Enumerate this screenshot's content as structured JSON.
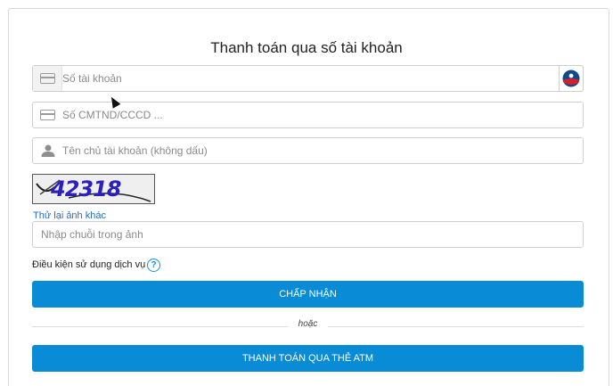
{
  "title": "Thanh toán qua số tài khoản",
  "fields": {
    "account_number": {
      "placeholder": "Số tài khoản",
      "icon": "card-icon"
    },
    "id_number": {
      "placeholder": "Số CMTND/CCCD ...",
      "icon": "card-icon"
    },
    "account_name": {
      "placeholder": "Tên chủ tài khoản (không dấu)",
      "icon": "user-icon"
    },
    "captcha_input": {
      "placeholder": "Nhập chuỗi trong ảnh"
    }
  },
  "captcha": {
    "text": "42318"
  },
  "retry_link": "Thử lại ảnh khác",
  "terms": {
    "label": "Điều kiện sử dụng dịch vụ",
    "help": "?"
  },
  "buttons": {
    "accept": "CHẤP NHẬN",
    "atm": "THANH TOÁN QUA THẺ ATM"
  },
  "divider": "hoặc",
  "colors": {
    "primary": "#0a8bd6",
    "link": "#1f6fbf",
    "captcha_text": "#2b1fbf"
  }
}
